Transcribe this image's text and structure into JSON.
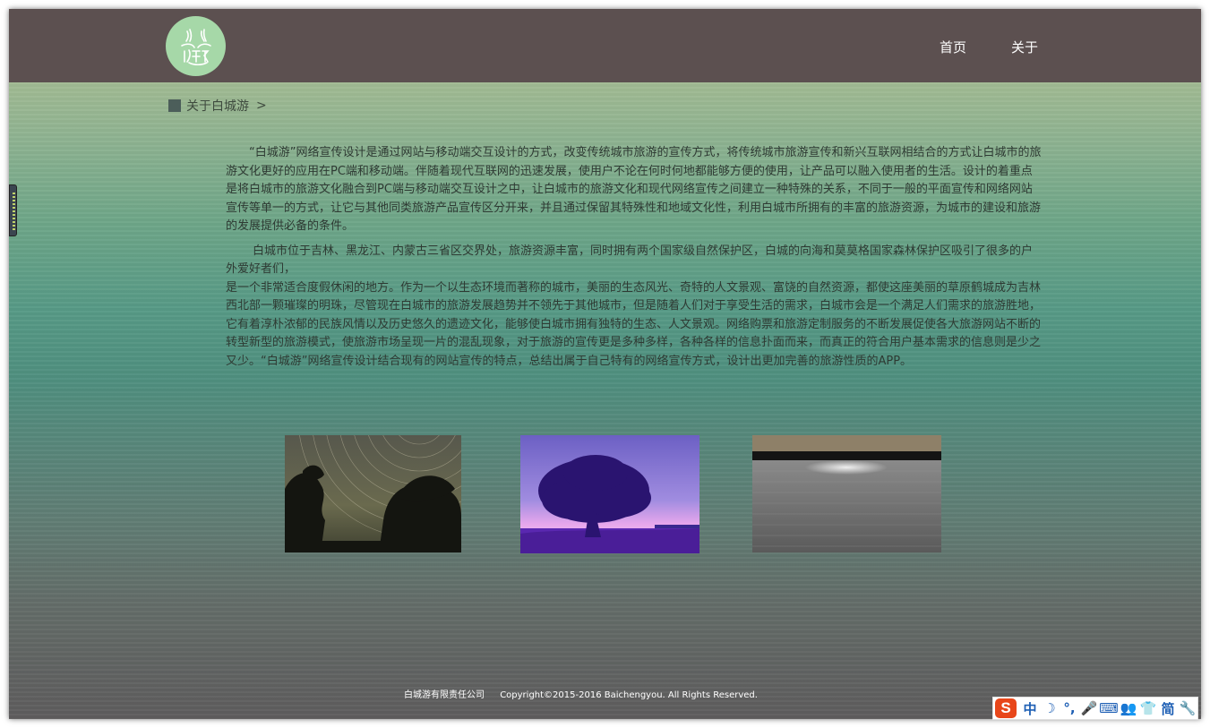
{
  "nav": {
    "home": "首页",
    "about": "关于"
  },
  "breadcrumb": {
    "label": "关于白城游",
    "arrow": ">"
  },
  "content": {
    "paragraph1": "“白城游”网络宣传设计是通过网站与移动端交互设计的方式，改变传统城市旅游的宣传方式，将传统城市旅游宣传和新兴互联网相结合的方式让白城市的旅游文化更好的应用在PC端和移动端。伴随着现代互联网的迅速发展，使用户不论在何时何地都能够方便的使用，让产品可以融入使用者的生活。设计的着重点是将白城市的旅游文化融合到PC端与移动端交互设计之中，让白城市的旅游文化和现代网络宣传之间建立一种特殊的关系，不同于一般的平面宣传和网络网站宣传等单一的方式，让它与其他同类旅游产品宣传区分开来，并且通过保留其特殊性和地域文化性，利用白城市所拥有的丰富的旅游资源，为城市的建设和旅游的发展提供必备的条件。",
    "paragraph2_line1": "白城市位于吉林、黑龙江、内蒙古三省区交界处，旅游资源丰富，同时拥有两个国家级自然保护区，白城的向海和莫莫格国家森林保护区吸引了很多的户外爱好者们，",
    "paragraph2_line2": "是一个非常适合度假休闲的地方。作为一个以生态环境而著称的城市，美丽的生态风光、奇特的人文景观、富饶的自然资源，都使这座美丽的草原鹤城成为吉林西北部一颗璀璨的明珠，尽管现在白城市的旅游发展趋势并不领先于其他城市，但是随着人们对于享受生活的需求，白城市会是一个满足人们需求的旅游胜地，它有着淳朴浓郁的民族风情以及历史悠久的遗迹文化，能够使白城市拥有独特的生态、人文景观。网络购票和旅游定制服务的不断发展促使各大旅游网站不断的转型新型的旅游模式，使旅游市场呈现一片的混乱现象，对于旅游的宣传更是多种多样，各种各样的信息扑面而来，而真正的符合用户基本需求的信息则是少之又少。“白城游”网络宣传设计结合现有的网站宣传的特点，总结出属于自己特有的网络宣传方式，设计出更加完善的旅游性质的APP。"
  },
  "footer": {
    "company": "白城游有限责任公司",
    "copyright": "Copyright©2015-2016 Baichengyou.  All Rights Reserved."
  },
  "ime": {
    "logo": "S",
    "items": [
      "中",
      "☽",
      "°,",
      "🎤",
      "⌨",
      "👥",
      "👕",
      "简",
      "🔧"
    ]
  },
  "colors": {
    "header_bg": "#5c5050",
    "logo_bg": "#a6d8a8",
    "ime_logo": "#e8461a",
    "ime_icon": "#1e5fb4"
  }
}
